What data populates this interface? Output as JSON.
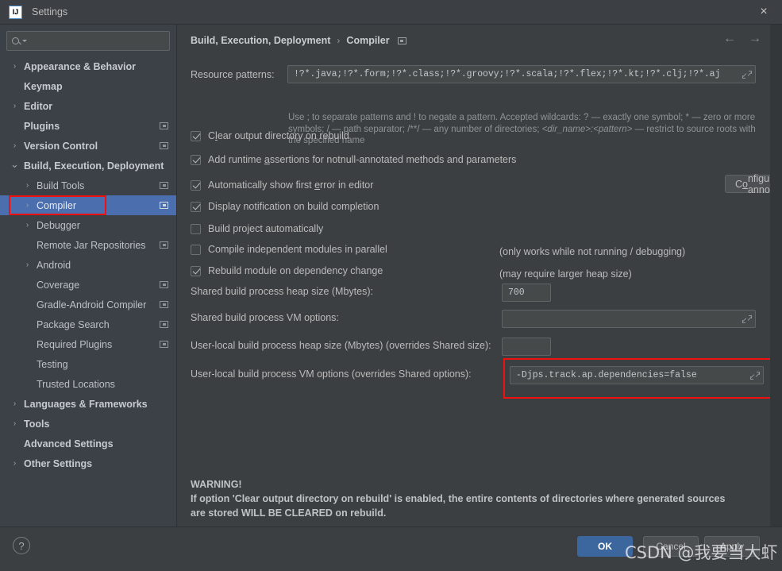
{
  "window": {
    "title": "Settings",
    "logo_text": "IJ",
    "close_icon": "×"
  },
  "sidebar": {
    "search_placeholder": "",
    "search_value": "",
    "items": [
      {
        "label": "Appearance & Behavior",
        "arrow": "›",
        "indent": 0,
        "bold": true,
        "badge": false,
        "selected": false
      },
      {
        "label": "Keymap",
        "arrow": "",
        "indent": 0,
        "bold": true,
        "badge": false,
        "selected": false
      },
      {
        "label": "Editor",
        "arrow": "›",
        "indent": 0,
        "bold": true,
        "badge": false,
        "selected": false
      },
      {
        "label": "Plugins",
        "arrow": "",
        "indent": 0,
        "bold": true,
        "badge": true,
        "selected": false
      },
      {
        "label": "Version Control",
        "arrow": "›",
        "indent": 0,
        "bold": true,
        "badge": true,
        "selected": false
      },
      {
        "label": "Build, Execution, Deployment",
        "arrow": "⌄",
        "indent": 0,
        "bold": true,
        "badge": false,
        "selected": false
      },
      {
        "label": "Build Tools",
        "arrow": "›",
        "indent": 1,
        "bold": false,
        "badge": true,
        "selected": false
      },
      {
        "label": "Compiler",
        "arrow": "›",
        "indent": 1,
        "bold": false,
        "badge": true,
        "selected": true
      },
      {
        "label": "Debugger",
        "arrow": "›",
        "indent": 1,
        "bold": false,
        "badge": false,
        "selected": false
      },
      {
        "label": "Remote Jar Repositories",
        "arrow": "",
        "indent": 1,
        "bold": false,
        "badge": true,
        "selected": false
      },
      {
        "label": "Android",
        "arrow": "›",
        "indent": 1,
        "bold": false,
        "badge": false,
        "selected": false
      },
      {
        "label": "Coverage",
        "arrow": "",
        "indent": 1,
        "bold": false,
        "badge": true,
        "selected": false
      },
      {
        "label": "Gradle-Android Compiler",
        "arrow": "",
        "indent": 1,
        "bold": false,
        "badge": true,
        "selected": false
      },
      {
        "label": "Package Search",
        "arrow": "",
        "indent": 1,
        "bold": false,
        "badge": true,
        "selected": false
      },
      {
        "label": "Required Plugins",
        "arrow": "",
        "indent": 1,
        "bold": false,
        "badge": true,
        "selected": false
      },
      {
        "label": "Testing",
        "arrow": "",
        "indent": 1,
        "bold": false,
        "badge": false,
        "selected": false
      },
      {
        "label": "Trusted Locations",
        "arrow": "",
        "indent": 1,
        "bold": false,
        "badge": false,
        "selected": false
      },
      {
        "label": "Languages & Frameworks",
        "arrow": "›",
        "indent": 0,
        "bold": true,
        "badge": false,
        "selected": false
      },
      {
        "label": "Tools",
        "arrow": "›",
        "indent": 0,
        "bold": true,
        "badge": false,
        "selected": false
      },
      {
        "label": "Advanced Settings",
        "arrow": "",
        "indent": 0,
        "bold": true,
        "badge": false,
        "selected": false
      },
      {
        "label": "Other Settings",
        "arrow": "›",
        "indent": 0,
        "bold": true,
        "badge": false,
        "selected": false
      }
    ]
  },
  "breadcrumb": {
    "root": "Build, Execution, Deployment",
    "separator": "›",
    "leaf": "Compiler",
    "back_icon": "←",
    "forward_icon": "→"
  },
  "main": {
    "resource_patterns": {
      "label": "Resource patterns:",
      "value": "!?*.java;!?*.form;!?*.class;!?*.groovy;!?*.scala;!?*.flex;!?*.kt;!?*.clj;!?*.aj"
    },
    "resource_hint_1": "Use ; to separate patterns and ! to negate a pattern. Accepted wildcards: ? — exactly one symbol; * — zero or",
    "resource_hint_2a": "more symbols; / — path separator; /**/ — any number of directories; ",
    "resource_hint_2b": "<dir_name>:<pattern>",
    "resource_hint_2c": " — restrict to source",
    "resource_hint_3": "roots with the specified name",
    "checkboxes": [
      {
        "label_pre": "C",
        "mnemonic": "l",
        "label_post": "ear output directory on rebuild",
        "checked": true
      },
      {
        "label_pre": "Add runtime ",
        "mnemonic": "a",
        "label_post": "ssertions for notnull-annotated methods and parameters",
        "checked": true
      },
      {
        "label_pre": "Automatically show first ",
        "mnemonic": "e",
        "label_post": "rror in editor",
        "checked": true
      },
      {
        "label_pre": "Display notification on build completion",
        "mnemonic": "",
        "label_post": "",
        "checked": true
      },
      {
        "label_pre": "Build project automatically",
        "mnemonic": "",
        "label_post": "",
        "checked": false
      },
      {
        "label_pre": "Compile independent modules in parallel",
        "mnemonic": "",
        "label_post": "",
        "checked": false
      },
      {
        "label_pre": "Rebuild module on dependency change",
        "mnemonic": "",
        "label_post": "",
        "checked": true
      }
    ],
    "configure_annotations_pre": "C",
    "configure_annotations_mn": "o",
    "configure_annotations_post": "nfigure annotations...",
    "note_build_auto": "(only works while not running / debugging)",
    "note_parallel": "(may require larger heap size)",
    "fields": [
      {
        "label": "Shared build process heap size (Mbytes):",
        "value": "700",
        "expandable": false
      },
      {
        "label": "Shared build process VM options:",
        "value": "",
        "expandable": true
      },
      {
        "label": "User-local build process heap size (Mbytes) (overrides Shared size):",
        "value": "",
        "expandable": false
      },
      {
        "label": "User-local build process VM options (overrides Shared options):",
        "value": "-Djps.track.ap.dependencies=false",
        "expandable": true
      }
    ],
    "warning_title": "WARNING!",
    "warning_line1": "If option 'Clear output directory on rebuild' is enabled, the entire contents of directories where generated sources",
    "warning_line2": "are stored WILL BE CLEARED on rebuild."
  },
  "footer": {
    "help_icon": "?",
    "ok": "OK",
    "cancel": "Cancel",
    "apply": "Apply"
  },
  "watermark": "CSDN @我要当大虾",
  "colors": {
    "accent_blue": "#4b6eaf",
    "ok_button": "#3c679e",
    "annotation_red": "#f01010",
    "panel_bg": "#3c3f41",
    "sidebar_bg": "#3c4148"
  }
}
